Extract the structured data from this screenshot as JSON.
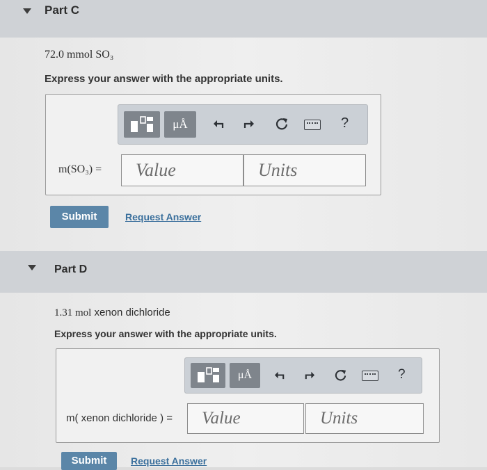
{
  "partC": {
    "title": "Part C",
    "quantity": "72.0 mmol SO₃",
    "instruction": "Express your answer with the appropriate units.",
    "label": "m(SO₃) =",
    "value_placeholder": "Value",
    "units_placeholder": "Units",
    "submit": "Submit",
    "request": "Request Answer"
  },
  "partD": {
    "title": "Part D",
    "quantity_amount": "1.31 mol",
    "quantity_name": "xenon dichloride",
    "instruction": "Express your answer with the appropriate units.",
    "label": "m( xenon dichloride ) =",
    "value_placeholder": "Value",
    "units_placeholder": "Units",
    "submit": "Submit",
    "request": "Request Answer"
  },
  "toolbar": {
    "units_button": "μÅ",
    "help": "?",
    "icons": [
      "templates-icon",
      "units-icon",
      "undo-icon",
      "redo-icon",
      "reset-icon",
      "keyboard-icon",
      "help-icon"
    ]
  }
}
